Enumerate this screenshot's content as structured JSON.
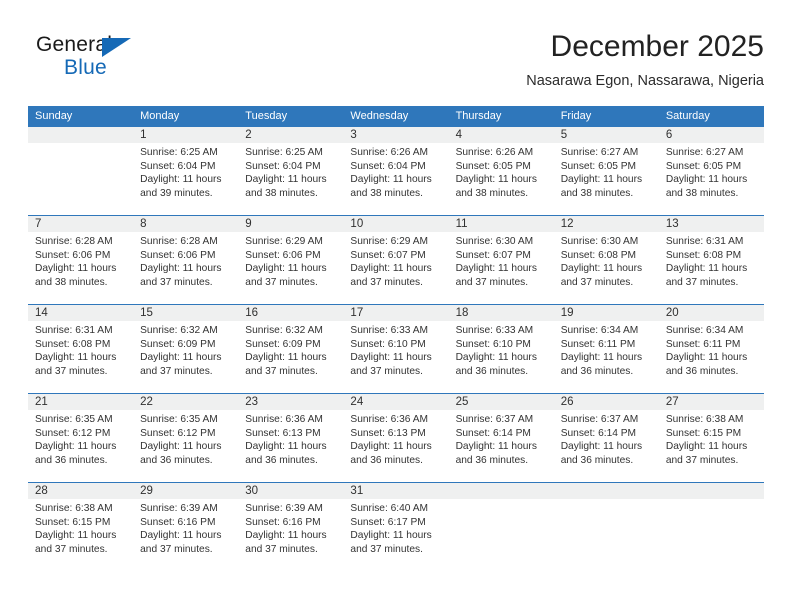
{
  "brand": {
    "name_part1": "General",
    "name_part2": "Blue",
    "accent_color": "#1569b6"
  },
  "header": {
    "title": "December 2025",
    "subtitle": "Nasarawa Egon, Nassarawa, Nigeria"
  },
  "calendar": {
    "header_bg_color": "#2f77bb",
    "weekdays": [
      "Sunday",
      "Monday",
      "Tuesday",
      "Wednesday",
      "Thursday",
      "Friday",
      "Saturday"
    ],
    "weeks": [
      [
        {
          "day": "",
          "sunrise": "",
          "sunset": "",
          "daylight": "",
          "empty": true
        },
        {
          "day": "1",
          "sunrise": "Sunrise: 6:25 AM",
          "sunset": "Sunset: 6:04 PM",
          "daylight": "Daylight: 11 hours and 39 minutes."
        },
        {
          "day": "2",
          "sunrise": "Sunrise: 6:25 AM",
          "sunset": "Sunset: 6:04 PM",
          "daylight": "Daylight: 11 hours and 38 minutes."
        },
        {
          "day": "3",
          "sunrise": "Sunrise: 6:26 AM",
          "sunset": "Sunset: 6:04 PM",
          "daylight": "Daylight: 11 hours and 38 minutes."
        },
        {
          "day": "4",
          "sunrise": "Sunrise: 6:26 AM",
          "sunset": "Sunset: 6:05 PM",
          "daylight": "Daylight: 11 hours and 38 minutes."
        },
        {
          "day": "5",
          "sunrise": "Sunrise: 6:27 AM",
          "sunset": "Sunset: 6:05 PM",
          "daylight": "Daylight: 11 hours and 38 minutes."
        },
        {
          "day": "6",
          "sunrise": "Sunrise: 6:27 AM",
          "sunset": "Sunset: 6:05 PM",
          "daylight": "Daylight: 11 hours and 38 minutes."
        }
      ],
      [
        {
          "day": "7",
          "sunrise": "Sunrise: 6:28 AM",
          "sunset": "Sunset: 6:06 PM",
          "daylight": "Daylight: 11 hours and 38 minutes."
        },
        {
          "day": "8",
          "sunrise": "Sunrise: 6:28 AM",
          "sunset": "Sunset: 6:06 PM",
          "daylight": "Daylight: 11 hours and 37 minutes."
        },
        {
          "day": "9",
          "sunrise": "Sunrise: 6:29 AM",
          "sunset": "Sunset: 6:06 PM",
          "daylight": "Daylight: 11 hours and 37 minutes."
        },
        {
          "day": "10",
          "sunrise": "Sunrise: 6:29 AM",
          "sunset": "Sunset: 6:07 PM",
          "daylight": "Daylight: 11 hours and 37 minutes."
        },
        {
          "day": "11",
          "sunrise": "Sunrise: 6:30 AM",
          "sunset": "Sunset: 6:07 PM",
          "daylight": "Daylight: 11 hours and 37 minutes."
        },
        {
          "day": "12",
          "sunrise": "Sunrise: 6:30 AM",
          "sunset": "Sunset: 6:08 PM",
          "daylight": "Daylight: 11 hours and 37 minutes."
        },
        {
          "day": "13",
          "sunrise": "Sunrise: 6:31 AM",
          "sunset": "Sunset: 6:08 PM",
          "daylight": "Daylight: 11 hours and 37 minutes."
        }
      ],
      [
        {
          "day": "14",
          "sunrise": "Sunrise: 6:31 AM",
          "sunset": "Sunset: 6:08 PM",
          "daylight": "Daylight: 11 hours and 37 minutes."
        },
        {
          "day": "15",
          "sunrise": "Sunrise: 6:32 AM",
          "sunset": "Sunset: 6:09 PM",
          "daylight": "Daylight: 11 hours and 37 minutes."
        },
        {
          "day": "16",
          "sunrise": "Sunrise: 6:32 AM",
          "sunset": "Sunset: 6:09 PM",
          "daylight": "Daylight: 11 hours and 37 minutes."
        },
        {
          "day": "17",
          "sunrise": "Sunrise: 6:33 AM",
          "sunset": "Sunset: 6:10 PM",
          "daylight": "Daylight: 11 hours and 37 minutes."
        },
        {
          "day": "18",
          "sunrise": "Sunrise: 6:33 AM",
          "sunset": "Sunset: 6:10 PM",
          "daylight": "Daylight: 11 hours and 36 minutes."
        },
        {
          "day": "19",
          "sunrise": "Sunrise: 6:34 AM",
          "sunset": "Sunset: 6:11 PM",
          "daylight": "Daylight: 11 hours and 36 minutes."
        },
        {
          "day": "20",
          "sunrise": "Sunrise: 6:34 AM",
          "sunset": "Sunset: 6:11 PM",
          "daylight": "Daylight: 11 hours and 36 minutes."
        }
      ],
      [
        {
          "day": "21",
          "sunrise": "Sunrise: 6:35 AM",
          "sunset": "Sunset: 6:12 PM",
          "daylight": "Daylight: 11 hours and 36 minutes."
        },
        {
          "day": "22",
          "sunrise": "Sunrise: 6:35 AM",
          "sunset": "Sunset: 6:12 PM",
          "daylight": "Daylight: 11 hours and 36 minutes."
        },
        {
          "day": "23",
          "sunrise": "Sunrise: 6:36 AM",
          "sunset": "Sunset: 6:13 PM",
          "daylight": "Daylight: 11 hours and 36 minutes."
        },
        {
          "day": "24",
          "sunrise": "Sunrise: 6:36 AM",
          "sunset": "Sunset: 6:13 PM",
          "daylight": "Daylight: 11 hours and 36 minutes."
        },
        {
          "day": "25",
          "sunrise": "Sunrise: 6:37 AM",
          "sunset": "Sunset: 6:14 PM",
          "daylight": "Daylight: 11 hours and 36 minutes."
        },
        {
          "day": "26",
          "sunrise": "Sunrise: 6:37 AM",
          "sunset": "Sunset: 6:14 PM",
          "daylight": "Daylight: 11 hours and 36 minutes."
        },
        {
          "day": "27",
          "sunrise": "Sunrise: 6:38 AM",
          "sunset": "Sunset: 6:15 PM",
          "daylight": "Daylight: 11 hours and 37 minutes."
        }
      ],
      [
        {
          "day": "28",
          "sunrise": "Sunrise: 6:38 AM",
          "sunset": "Sunset: 6:15 PM",
          "daylight": "Daylight: 11 hours and 37 minutes."
        },
        {
          "day": "29",
          "sunrise": "Sunrise: 6:39 AM",
          "sunset": "Sunset: 6:16 PM",
          "daylight": "Daylight: 11 hours and 37 minutes."
        },
        {
          "day": "30",
          "sunrise": "Sunrise: 6:39 AM",
          "sunset": "Sunset: 6:16 PM",
          "daylight": "Daylight: 11 hours and 37 minutes."
        },
        {
          "day": "31",
          "sunrise": "Sunrise: 6:40 AM",
          "sunset": "Sunset: 6:17 PM",
          "daylight": "Daylight: 11 hours and 37 minutes."
        },
        {
          "day": "",
          "sunrise": "",
          "sunset": "",
          "daylight": "",
          "empty": true
        },
        {
          "day": "",
          "sunrise": "",
          "sunset": "",
          "daylight": "",
          "empty": true
        },
        {
          "day": "",
          "sunrise": "",
          "sunset": "",
          "daylight": "",
          "empty": true
        }
      ]
    ]
  }
}
